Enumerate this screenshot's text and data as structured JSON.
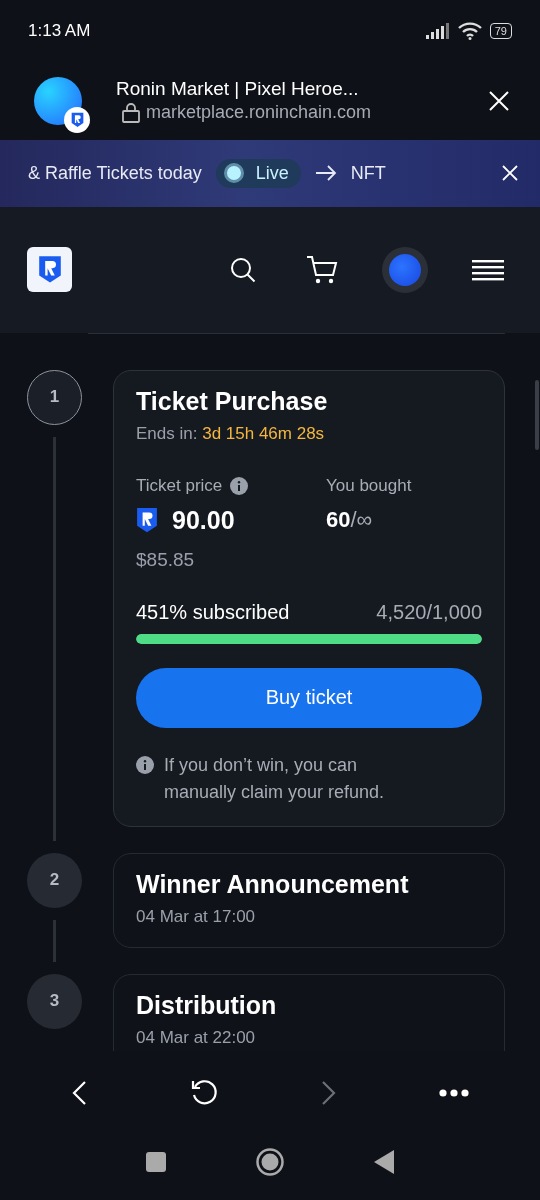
{
  "status_bar": {
    "time": "1:13 AM",
    "battery": "79"
  },
  "browser": {
    "title": "Ronin Market | Pixel Heroe...",
    "url": "marketplace.roninchain.com"
  },
  "banner": {
    "text": "& Raffle Tickets today",
    "live_label": "Live",
    "next_text": "NFT"
  },
  "steps": [
    {
      "kind": "purchase",
      "number": "1",
      "active": true,
      "title": "Ticket Purchase",
      "ends_label": "Ends in:",
      "countdown": "3d 15h 46m 28s",
      "price_label": "Ticket price",
      "price": "90.00",
      "price_usd": "$85.85",
      "bought_label": "You bought",
      "bought": "60",
      "bought_limit": "/∞",
      "subscribed": "451% subscribed",
      "sold": "4,520/1,000",
      "level": 1,
      "button": "Buy ticket",
      "note": "If you don’t win, you can manually claim your refund."
    },
    {
      "kind": "event",
      "number": "2",
      "active": false,
      "title": "Winner Announcement",
      "date": "04 Mar at 17:00"
    },
    {
      "kind": "event",
      "number": "3",
      "active": false,
      "title": "Distribution",
      "date": "04 Mar at 22:00"
    }
  ],
  "browser_nav": {
    "forward_disabled": true
  }
}
